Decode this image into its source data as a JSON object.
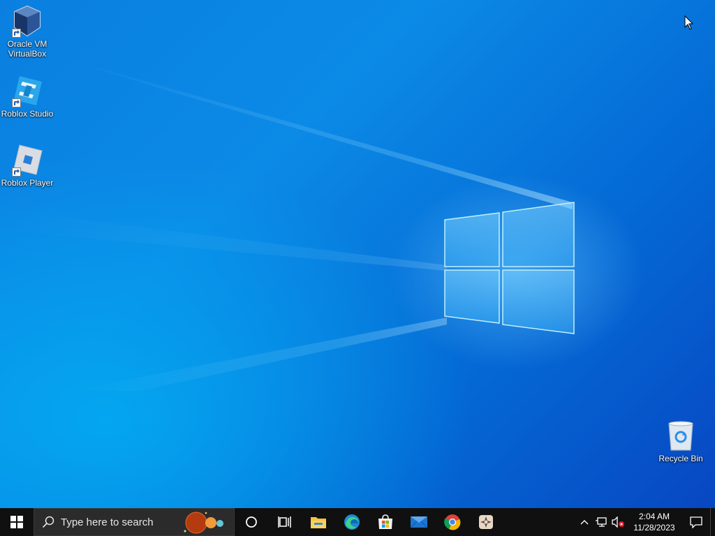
{
  "desktop": {
    "icons": [
      {
        "label": "Oracle VM\nVirtualBox",
        "icon": "virtualbox-icon"
      },
      {
        "label": "Roblox Studio",
        "icon": "roblox-studio-icon"
      },
      {
        "label": "Roblox Player",
        "icon": "roblox-player-icon"
      },
      {
        "label": "Recycle Bin",
        "icon": "recycle-bin-icon"
      }
    ]
  },
  "taskbar": {
    "start_icon": "windows-start-icon",
    "search_placeholder": "Type here to search",
    "pinned": [
      {
        "name": "Cortana",
        "icon": "cortana-icon"
      },
      {
        "name": "Task View",
        "icon": "task-view-icon"
      },
      {
        "name": "File Explorer",
        "icon": "file-explorer-icon"
      },
      {
        "name": "Microsoft Edge",
        "icon": "edge-icon"
      },
      {
        "name": "Microsoft Store",
        "icon": "store-icon"
      },
      {
        "name": "Mail",
        "icon": "mail-icon"
      },
      {
        "name": "Google Chrome",
        "icon": "chrome-icon"
      },
      {
        "name": "App",
        "icon": "app-icon"
      }
    ],
    "tray": {
      "time": "2:04 AM",
      "date": "11/28/2023"
    }
  },
  "colors": {
    "accent": "#0078d7",
    "taskbar": "#101010",
    "search_box": "#2b2b2b"
  }
}
